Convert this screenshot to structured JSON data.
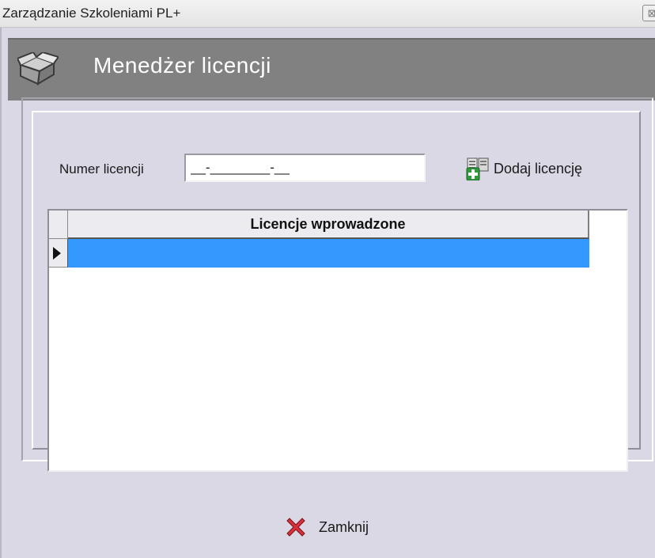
{
  "window": {
    "title": "Zarządzanie Szkoleniami PL+",
    "close_glyph": "⊠"
  },
  "header": {
    "title": "Menedżer licencji",
    "icon": "open-box-icon"
  },
  "form": {
    "license_label": "Numer licencji",
    "license_value": "__-________-__",
    "add_button_label": "Dodaj licencję",
    "add_button_icon": "add-document-icon"
  },
  "grid": {
    "columns": [
      "Licencje wprowadzone"
    ],
    "rows": [
      ""
    ],
    "selected_row_color": "#3399ff"
  },
  "footer": {
    "close_label": "Zamknij",
    "close_icon": "red-x-icon"
  }
}
